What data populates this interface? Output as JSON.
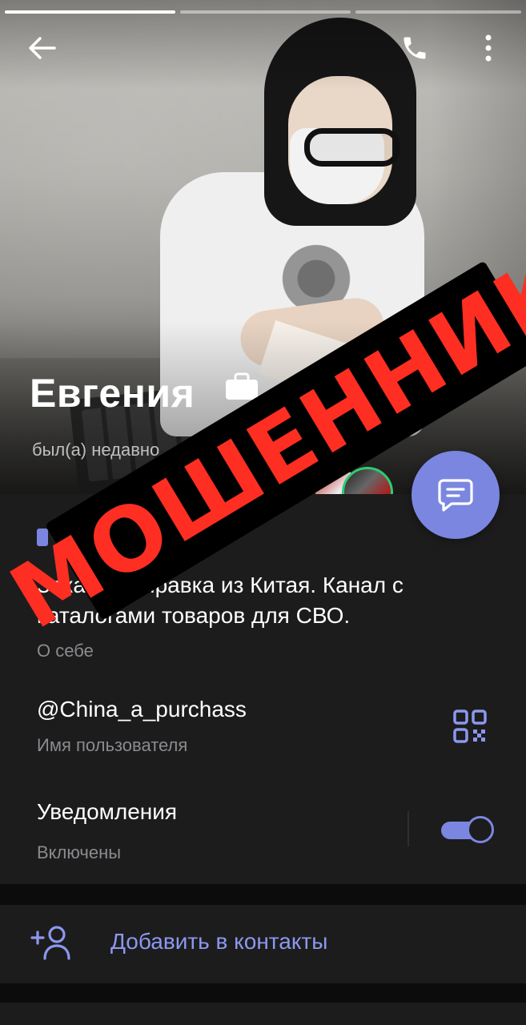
{
  "profile": {
    "name": "Евгения",
    "status": "был(а) недавно",
    "bio": "Заказ и отправка из Китая. Канал с каталогами товаров для СВО.",
    "bio_label": "О себе",
    "username": "@China_a_purchass",
    "username_label": "Имя пользователя",
    "notifications_title": "Уведомления",
    "notifications_state": "Включены",
    "notifications_enabled": true
  },
  "actions": {
    "add_contact": "Добавить в контакты"
  },
  "overlay": {
    "warning_text": "МОШЕННИК"
  },
  "stories": {
    "count": 3,
    "active_index": 0
  },
  "icons": {
    "back": "arrow-left-icon",
    "call": "phone-icon",
    "more": "more-vertical-icon",
    "message": "chat-bubble-icon",
    "qr": "qr-code-icon",
    "add_contact": "add-user-icon",
    "briefcase": "briefcase-icon"
  },
  "colors": {
    "accent": "#7b86e0",
    "warning": "#ff2e22",
    "background": "#1c1c1d"
  }
}
